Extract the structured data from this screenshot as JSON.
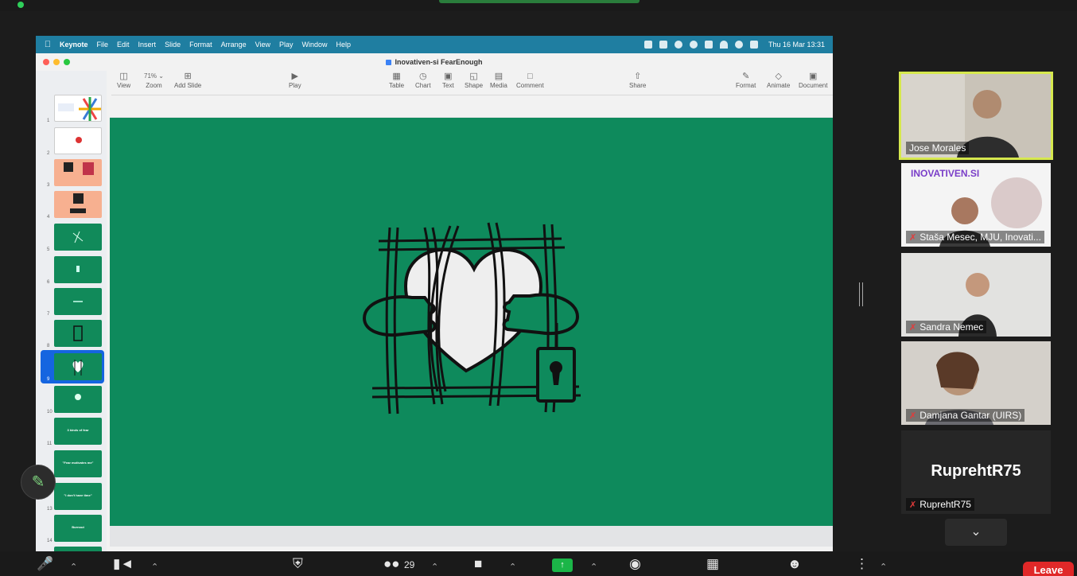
{
  "mac_menu": {
    "app": "Keynote",
    "items": [
      "File",
      "Edit",
      "Insert",
      "Slide",
      "Format",
      "Arrange",
      "View",
      "Play",
      "Window",
      "Help"
    ],
    "clock": "Thu 16 Mar 13:31"
  },
  "keynote": {
    "doc_title": "Inovativen-si FearEnough",
    "toolbar": {
      "view": "View",
      "zoom_value": "71%",
      "zoom": "Zoom",
      "add_slide": "Add Slide",
      "play": "Play",
      "table": "Table",
      "chart": "Chart",
      "text": "Text",
      "shape": "Shape",
      "media": "Media",
      "comment": "Comment",
      "share": "Share",
      "format": "Format",
      "animate": "Animate",
      "document": "Document"
    },
    "slides": [
      {
        "num": "1",
        "text": ""
      },
      {
        "num": "2",
        "text": ""
      },
      {
        "num": "3",
        "text": ""
      },
      {
        "num": "4",
        "text": ""
      },
      {
        "num": "5",
        "text": ""
      },
      {
        "num": "6",
        "text": ""
      },
      {
        "num": "7",
        "text": ""
      },
      {
        "num": "8",
        "text": ""
      },
      {
        "num": "9",
        "text": ""
      },
      {
        "num": "10",
        "text": ""
      },
      {
        "num": "11",
        "text": "3 kinds of fear"
      },
      {
        "num": "12",
        "text": "\"Fear motivates me\""
      },
      {
        "num": "13",
        "text": "\"I don't have time\""
      },
      {
        "num": "14",
        "text": "Burnout"
      }
    ],
    "selected_slide": "9",
    "slide_bg": "#0e8a5c"
  },
  "participants": [
    {
      "name": "Jose Morales",
      "muted": false,
      "active": true
    },
    {
      "name": "Staša Mesec, MJU, Inovati...",
      "muted": true,
      "active": false,
      "logo_text": "INOVATIVEN.SI"
    },
    {
      "name": "Sandra Nemec",
      "muted": true,
      "active": false
    },
    {
      "name": "Damjana Gantar (UIRS)",
      "muted": true,
      "active": false
    },
    {
      "name": "RuprehtR75",
      "muted": true,
      "active": false,
      "no_video_name": "RuprehtR75"
    }
  ],
  "zoom_toolbar": {
    "participants_count": "29",
    "leave": "Leave"
  }
}
